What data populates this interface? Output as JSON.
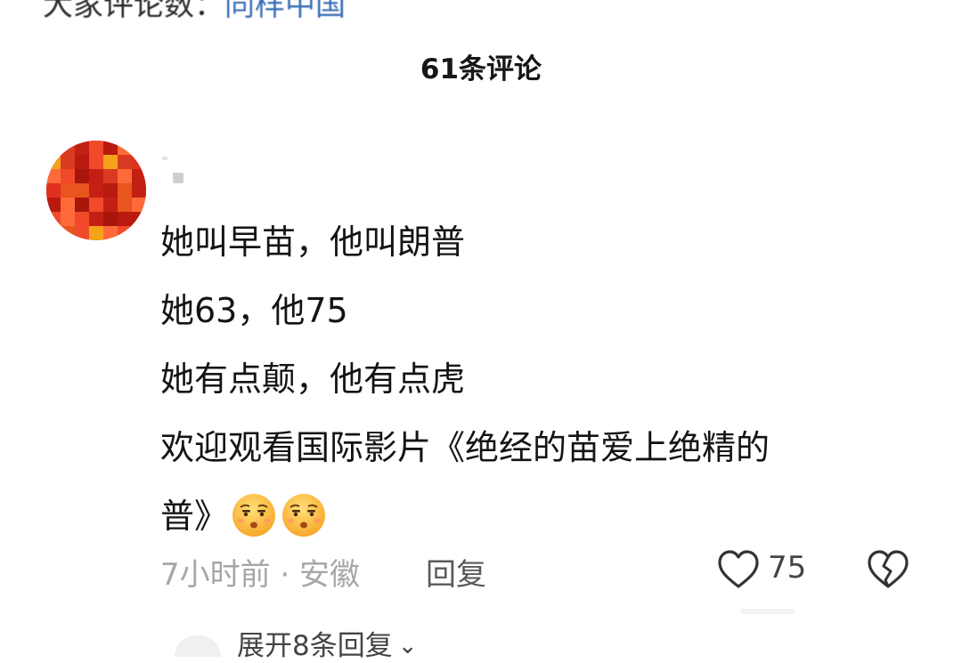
{
  "top_partial": {
    "text": "大家评论数：",
    "link_text": "同样中国"
  },
  "header": {
    "comment_count_title": "61条评论"
  },
  "comment": {
    "lines": [
      "她叫早苗，他叫朗普",
      "她63，他75",
      "她有点颠，他有点虎",
      "欢迎观看国际影片《绝经的苗爱上绝精的",
      "普》"
    ],
    "emojis": [
      "smirk-face-emoji",
      "smirk-face-emoji"
    ],
    "time_location": "7小时前 · 安徽",
    "reply_label": "回复",
    "like_count": "75",
    "like_icon": "heart-outline-icon",
    "dislike_icon": "broken-heart-icon"
  },
  "replies": {
    "expand_label": "展开8条回复",
    "expand_icon": "chevron-down-icon"
  },
  "colors": {
    "text_primary": "#141414",
    "text_secondary": "#a6a6a6",
    "link": "#3a6fb5",
    "avatar_red": "#d42a1f"
  }
}
